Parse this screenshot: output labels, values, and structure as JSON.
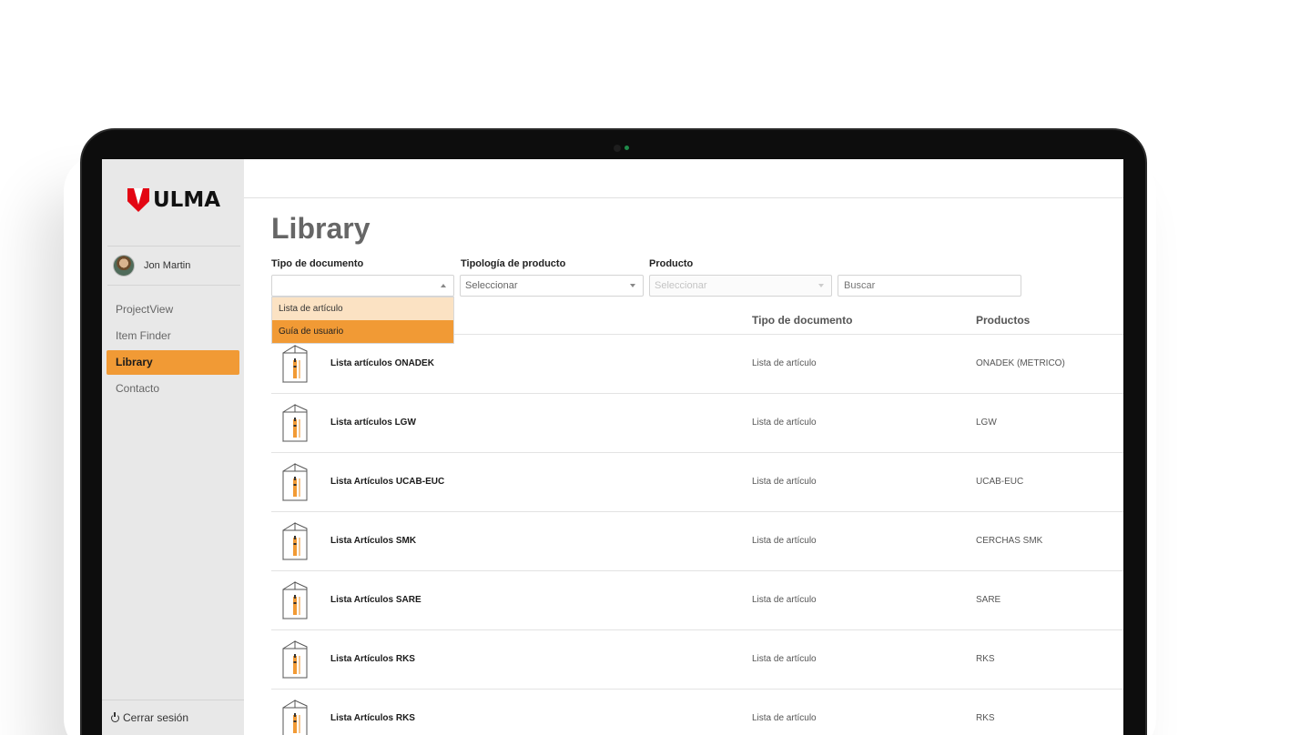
{
  "brand": {
    "name": "ULMA"
  },
  "user": {
    "name": "Jon Martin"
  },
  "nav": {
    "items": [
      {
        "label": "ProjectView",
        "active": false
      },
      {
        "label": "Item Finder",
        "active": false
      },
      {
        "label": "Library",
        "active": true
      },
      {
        "label": "Contacto",
        "active": false
      }
    ],
    "logout_label": "Cerrar sesión"
  },
  "page": {
    "title": "Library"
  },
  "filters": {
    "doc_type": {
      "label": "Tipo de documento",
      "value": ""
    },
    "product_type": {
      "label": "Tipología de producto",
      "value": "Seleccionar"
    },
    "product": {
      "label": "Producto",
      "value": "Seleccionar",
      "disabled": true
    },
    "search": {
      "placeholder": "Buscar"
    }
  },
  "dropdown": {
    "options": [
      {
        "label": "Lista de artículo",
        "selected": false
      },
      {
        "label": "Guía de usuario",
        "selected": true
      }
    ]
  },
  "table": {
    "columns": {
      "type": "Tipo de documento",
      "products": "Productos"
    },
    "rows": [
      {
        "title": "Lista artículos ONADEK",
        "type": "Lista de artículo",
        "product": "ONADEK (METRICO)"
      },
      {
        "title": "Lista artículos LGW",
        "type": "Lista de artículo",
        "product": "LGW"
      },
      {
        "title": "Lista Artículos UCAB-EUC",
        "type": "Lista de artículo",
        "product": "UCAB-EUC"
      },
      {
        "title": "Lista Artículos SMK",
        "type": "Lista de artículo",
        "product": "CERCHAS SMK"
      },
      {
        "title": "Lista Artículos SARE",
        "type": "Lista de artículo",
        "product": "SARE"
      },
      {
        "title": "Lista Artículos RKS",
        "type": "Lista de artículo",
        "product": "RKS"
      },
      {
        "title": "Lista Artículos RKS",
        "type": "Lista de artículo",
        "product": "RKS"
      }
    ]
  },
  "colors": {
    "accent": "#f19a35",
    "accent_light": "#fbe2c3",
    "logo_red": "#e30613",
    "sidebar_bg": "#e8e8e8"
  },
  "icons": {
    "document": "folded-document-icon",
    "logout": "power-icon"
  }
}
